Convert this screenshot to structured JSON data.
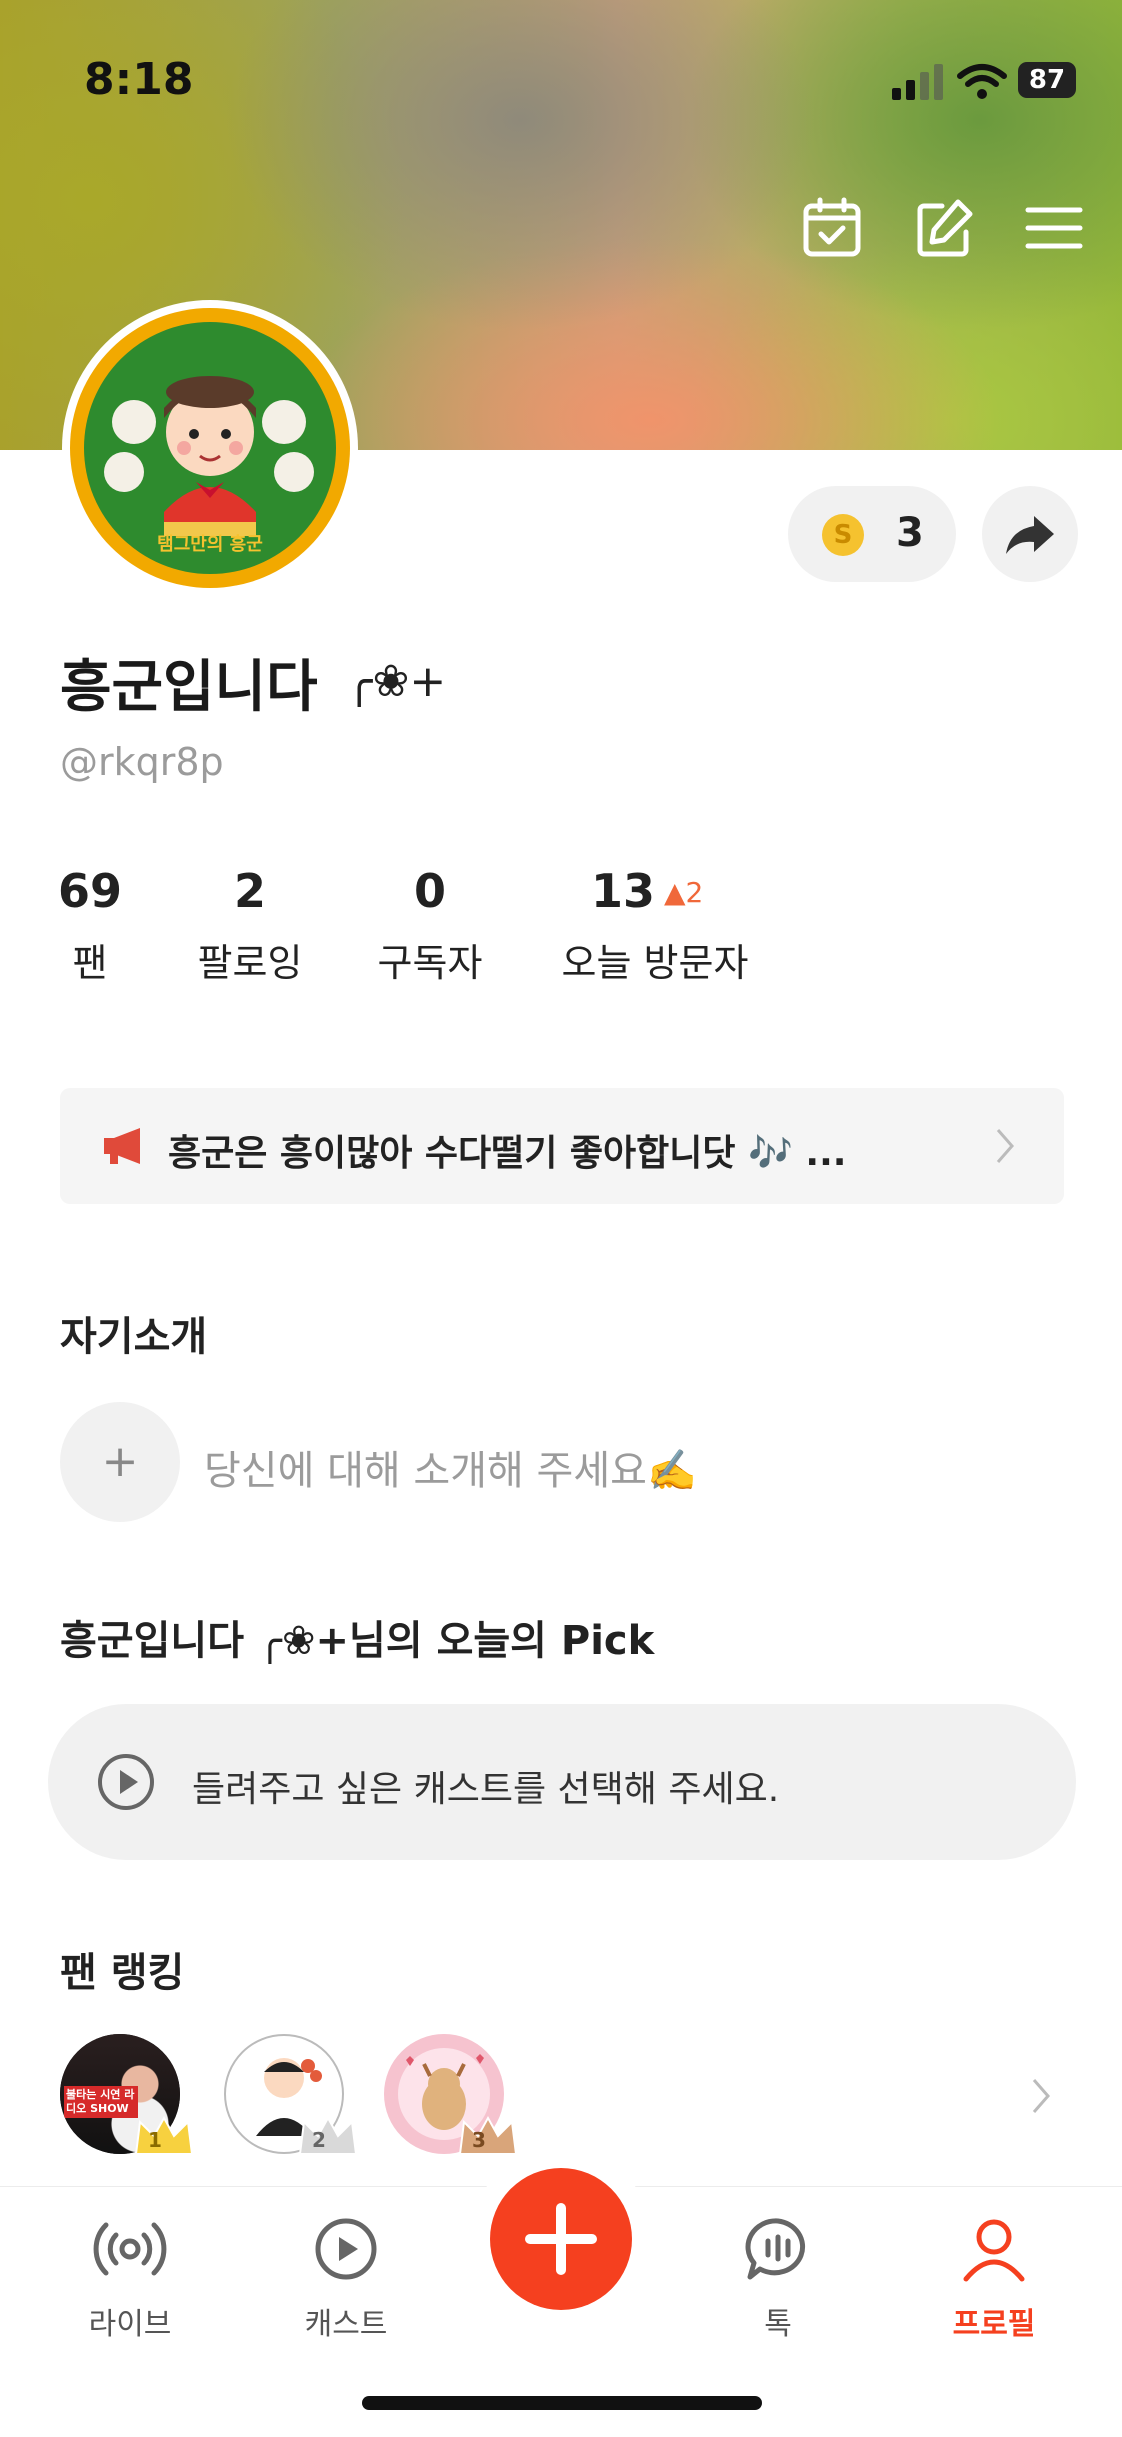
{
  "status_bar": {
    "time": "8:18",
    "battery": "87"
  },
  "profile": {
    "nickname": "흥군입니다",
    "nickname_deco": "╭❀+",
    "handle": "@rkqr8p",
    "avatar_caption": "탬그만의 흥군",
    "coins": "3"
  },
  "stats": [
    {
      "value": "69",
      "label": "팬"
    },
    {
      "value": "2",
      "label": "팔로잉"
    },
    {
      "value": "0",
      "label": "구독자"
    },
    {
      "value": "13",
      "label": "오늘 방문자",
      "delta": "▲2"
    }
  ],
  "notice": {
    "text": "흥군은 흥이많아 수다떨기 좋아합니닷 🎶 ..."
  },
  "intro": {
    "title": "자기소개",
    "placeholder": "당신에 대해 소개해 주세요✍️"
  },
  "pick": {
    "title": "흥군입니다 ╭❀+님의 오늘의 Pick",
    "placeholder": "들려주고 싶은 캐스트를 선택해 주세요."
  },
  "fan_ranking": {
    "title": "팬 랭킹",
    "ranks": [
      "1",
      "2",
      "3"
    ],
    "first_fan_caption": "불타는 시연 라디오 SHOW"
  },
  "bottom_nav": {
    "items": [
      {
        "label": "라이브",
        "icon": "live-icon"
      },
      {
        "label": "캐스트",
        "icon": "play-icon"
      },
      {
        "label": "톡",
        "icon": "chat-icon"
      },
      {
        "label": "프로필",
        "icon": "profile-icon"
      }
    ],
    "accent": "#f5401f"
  }
}
